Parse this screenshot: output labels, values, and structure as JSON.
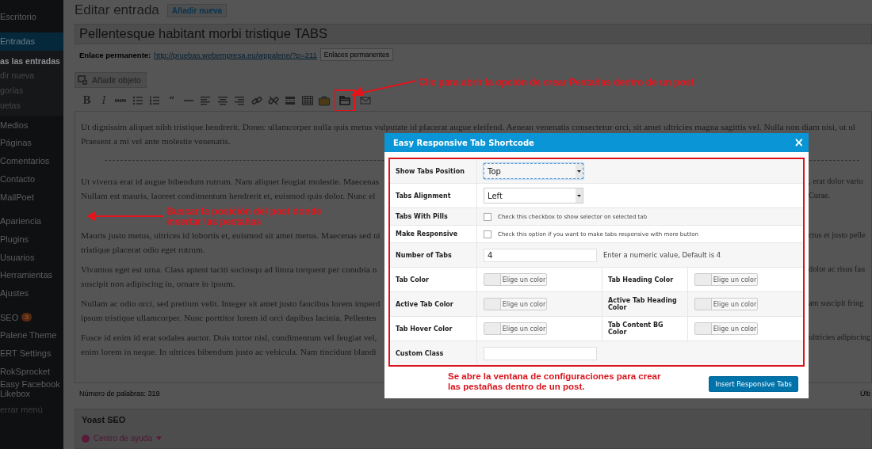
{
  "sidebar": {
    "groups": [
      {
        "items": [
          {
            "label": "Escritorio",
            "selected": false
          }
        ]
      },
      {
        "items": [
          {
            "label": "Entradas",
            "selected": true,
            "children": [
              {
                "label": "as las entradas",
                "selected": true
              },
              {
                "label": "dir nueva",
                "selected": false
              },
              {
                "label": "gorías",
                "selected": false
              },
              {
                "label": "uetas",
                "selected": false
              }
            ]
          },
          {
            "label": "Medios",
            "selected": false
          },
          {
            "label": "Páginas",
            "selected": false
          },
          {
            "label": "Comentarios",
            "selected": false
          },
          {
            "label": "Contacto",
            "selected": false
          },
          {
            "label": "MailPoet",
            "selected": false
          }
        ]
      },
      {
        "items": [
          {
            "label": "Apariencia",
            "selected": false
          },
          {
            "label": "Plugins",
            "selected": false
          },
          {
            "label": "Usuarios",
            "selected": false
          },
          {
            "label": "Herramientas",
            "selected": false
          },
          {
            "label": "Ajustes",
            "selected": false
          }
        ]
      },
      {
        "items": [
          {
            "label": "SEO",
            "selected": false,
            "badge": "3"
          },
          {
            "label": "Palene Theme",
            "selected": false
          },
          {
            "label": "ERT Settings",
            "selected": false
          },
          {
            "label": "RokSprocket",
            "selected": false
          },
          {
            "label": "Easy Facebook Likebox",
            "selected": false
          }
        ]
      }
    ],
    "collapse": "errar menú"
  },
  "header": {
    "title": "Editar entrada",
    "add_new": "Añadir nueva"
  },
  "post_title": "Pellentesque habitant morbi tristique TABS",
  "permalink": {
    "label": "Enlace permanente:",
    "url": "http://pruebas.webempresa.eu/wppalene/?p=211",
    "button": "Enlaces permanentes"
  },
  "add_media": "Añadir objeto",
  "toolbar": [
    {
      "kind": "text",
      "label": "B",
      "highlighted": false
    },
    {
      "kind": "text",
      "label": "I",
      "highlighted": false
    },
    {
      "kind": "strike",
      "highlighted": false
    },
    {
      "kind": "bullets",
      "highlighted": false
    },
    {
      "kind": "numbers",
      "highlighted": false
    },
    {
      "kind": "text",
      "label": "“",
      "highlighted": false
    },
    {
      "kind": "hr",
      "highlighted": false
    },
    {
      "kind": "align-left",
      "highlighted": false
    },
    {
      "kind": "align-center",
      "highlighted": false
    },
    {
      "kind": "align-right",
      "highlighted": false
    },
    {
      "kind": "link",
      "highlighted": false
    },
    {
      "kind": "unlink",
      "highlighted": false
    },
    {
      "kind": "readmore",
      "highlighted": false
    },
    {
      "kind": "table",
      "highlighted": false
    },
    {
      "kind": "briefcase",
      "highlighted": false
    },
    {
      "kind": "tabs",
      "highlighted": true
    },
    {
      "kind": "mail",
      "highlighted": false
    }
  ],
  "editor": {
    "blocks": [
      {
        "kind": "paragraph",
        "lines": [
          {
            "left": "Ut dignissim aliquet nibh tristique hendrerit. Donec ullamcorper nulla quis metus vulputate id placerat augue eleifend. Aenean venenatis consectetur orci, sit amet ultricies magna sagittis vel. Nulla non diam nisi, ut ul"
          },
          {
            "left": "Praesent a mi vel ante molestie venenatis."
          }
        ]
      },
      {
        "kind": "more"
      },
      {
        "kind": "paragraph",
        "lines": [
          {
            "left": "Ut viverra erat id augue bibendum rutrum. Nam aliquet feugiat molestie. Maecenas",
            "right": ", erat dolor variu"
          },
          {
            "left": "Nullam est mauris, laoreet condimentum hendrerit et, euismod quis dolor. Nunc el",
            "right": "Curae."
          }
        ]
      },
      {
        "kind": "blank"
      },
      {
        "kind": "paragraph",
        "lines": [
          {
            "left": "Mauris justo metus, ultrices id lobortis et, euismod sit amet metus. Maecenas sed ni",
            "right": "ctus et justo pelle"
          },
          {
            "left": "tristique placerat odio eget rutrum."
          }
        ]
      },
      {
        "kind": "paragraph",
        "lines": [
          {
            "left": "Vivamus eget est urna. Class aptent taciti sociosqu ad litora torquent per conubia n",
            "right": "dolor ac risus fau"
          },
          {
            "left": "suscipit non adipiscing in, ornare in ipsum."
          }
        ]
      },
      {
        "kind": "paragraph",
        "lines": [
          {
            "left": "Nullam ac odio orci, sed pretium velit. Integer sit amet justo faucibus lorem imperd",
            "right": "am suscipit fring"
          },
          {
            "left": "ipsum tristique ullamcorper. Nunc porttitor lorem id orci dapibus lacinia. Pellentes"
          }
        ]
      },
      {
        "kind": "paragraph",
        "lines": [
          {
            "left": "Fusce id enim id erat sodales auctor. Duis tortor nisl, condimentum vel feugiat vel,",
            "right": "ultricies adipiscing"
          },
          {
            "left": "enim lorem in neque. In ultrices bibendum justo ac vehicula. Nam tincidunt blandi"
          }
        ]
      }
    ],
    "word_count": "Número de palabras: 319",
    "last_edit": "Últi"
  },
  "yoast": {
    "title": "Yoast SEO",
    "help": "Centro de ayuda"
  },
  "dialog": {
    "title": "Easy Responsive Tab Shortcode",
    "close": "×",
    "rows": [
      {
        "kind": "select",
        "label": "Show Tabs Position",
        "value": "Top",
        "focused": true
      },
      {
        "kind": "select",
        "label": "Tabs Alignment",
        "value": "Left",
        "focused": false
      },
      {
        "kind": "checkbox",
        "label": "Tabs With Pills",
        "checked": false,
        "hint": "Check this checkbox to show selector on selected tab"
      },
      {
        "kind": "checkbox",
        "label": "Make Responsive",
        "checked": false,
        "hint": "Check this option if you want to make tabs responsive with more button"
      },
      {
        "kind": "number",
        "label": "Number of Tabs",
        "value": "4",
        "hint": "Enter a numeric value, Default is 4"
      },
      {
        "kind": "colors",
        "pickers": [
          {
            "label": "Tab Color",
            "button": "Elige un color"
          },
          {
            "label": "Tab Heading Color",
            "button": "Elige un color"
          }
        ]
      },
      {
        "kind": "colors",
        "pickers": [
          {
            "label": "Active Tab Color",
            "button": "Elige un color"
          },
          {
            "label": "Active Tab Heading Color",
            "button": "Elige un color"
          }
        ]
      },
      {
        "kind": "colors",
        "pickers": [
          {
            "label": "Tab Hover Color",
            "button": "Elige un color"
          },
          {
            "label": "Tab Content BG Color",
            "button": "Elige un color"
          }
        ]
      },
      {
        "kind": "text",
        "label": "Custom Class"
      }
    ],
    "note": "Se abre la ventana de configuraciones para crear las pestañas dentro de un post.",
    "submit": "Insert Responsive Tabs"
  },
  "annotations": [
    {
      "kind": "toolbar",
      "text": "Clic para abrir la opción de crear Pestañas dentro de un post"
    },
    {
      "kind": "editor",
      "text": "Buscar la posición del post donde insertar las pestañas"
    }
  ]
}
